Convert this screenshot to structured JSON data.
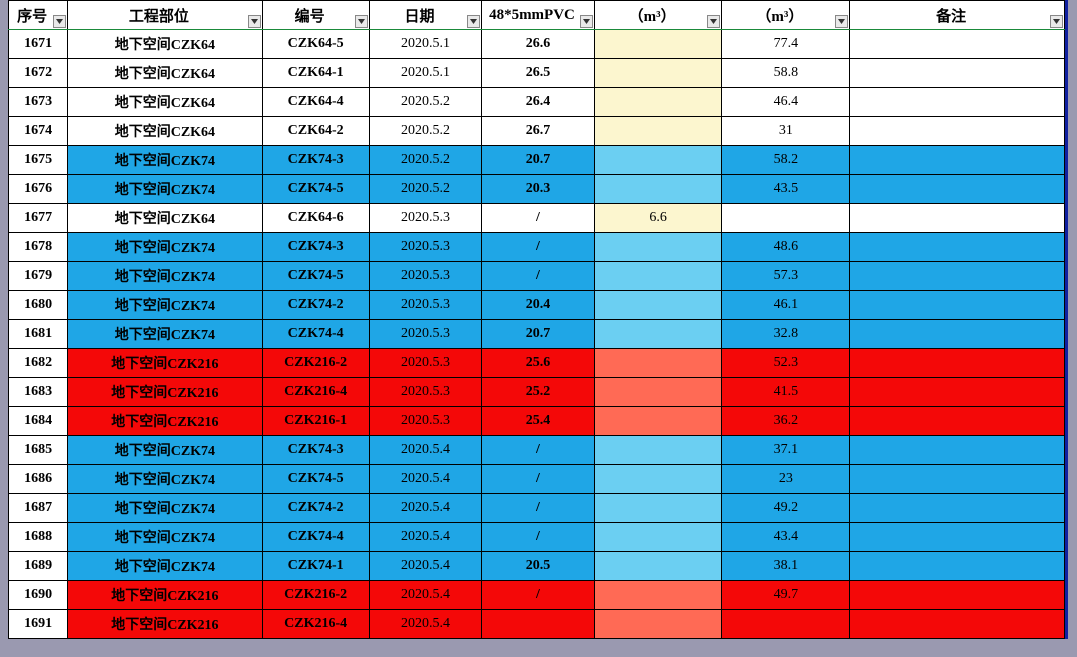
{
  "headers": {
    "seq": "序号",
    "part": "工程部位",
    "code": "编号",
    "date": "日期",
    "pvc": "48*5mmPVC",
    "m3a": "（m³）",
    "m3b": "（m³）",
    "remark": "备注"
  },
  "rows": [
    {
      "seq": "1671",
      "part": "地下空间CZK64",
      "code": "CZK64-5",
      "date": "2020.5.1",
      "pvc": "26.6",
      "m3a": "",
      "m3b": "77.4",
      "remark": "",
      "fill": "white",
      "c5": "cream"
    },
    {
      "seq": "1672",
      "part": "地下空间CZK64",
      "code": "CZK64-1",
      "date": "2020.5.1",
      "pvc": "26.5",
      "m3a": "",
      "m3b": "58.8",
      "remark": "",
      "fill": "white",
      "c5": "cream"
    },
    {
      "seq": "1673",
      "part": "地下空间CZK64",
      "code": "CZK64-4",
      "date": "2020.5.2",
      "pvc": "26.4",
      "m3a": "",
      "m3b": "46.4",
      "remark": "",
      "fill": "white",
      "c5": "cream"
    },
    {
      "seq": "1674",
      "part": "地下空间CZK64",
      "code": "CZK64-2",
      "date": "2020.5.2",
      "pvc": "26.7",
      "m3a": "",
      "m3b": "31",
      "remark": "",
      "fill": "white",
      "c5": "cream"
    },
    {
      "seq": "1675",
      "part": "地下空间CZK74",
      "code": "CZK74-3",
      "date": "2020.5.2",
      "pvc": "20.7",
      "m3a": "",
      "m3b": "58.2",
      "remark": "",
      "fill": "blue",
      "c5": "ltblue"
    },
    {
      "seq": "1676",
      "part": "地下空间CZK74",
      "code": "CZK74-5",
      "date": "2020.5.2",
      "pvc": "20.3",
      "m3a": "",
      "m3b": "43.5",
      "remark": "",
      "fill": "blue",
      "c5": "ltblue"
    },
    {
      "seq": "1677",
      "part": "地下空间CZK64",
      "code": "CZK64-6",
      "date": "2020.5.3",
      "pvc": "/",
      "m3a": "6.6",
      "m3b": "",
      "remark": "",
      "fill": "white",
      "c5": "cream"
    },
    {
      "seq": "1678",
      "part": "地下空间CZK74",
      "code": "CZK74-3",
      "date": "2020.5.3",
      "pvc": "/",
      "m3a": "",
      "m3b": "48.6",
      "remark": "",
      "fill": "blue",
      "c5": "ltblue"
    },
    {
      "seq": "1679",
      "part": "地下空间CZK74",
      "code": "CZK74-5",
      "date": "2020.5.3",
      "pvc": "/",
      "m3a": "",
      "m3b": "57.3",
      "remark": "",
      "fill": "blue",
      "c5": "ltblue"
    },
    {
      "seq": "1680",
      "part": "地下空间CZK74",
      "code": "CZK74-2",
      "date": "2020.5.3",
      "pvc": "20.4",
      "m3a": "",
      "m3b": "46.1",
      "remark": "",
      "fill": "blue",
      "c5": "ltblue"
    },
    {
      "seq": "1681",
      "part": "地下空间CZK74",
      "code": "CZK74-4",
      "date": "2020.5.3",
      "pvc": "20.7",
      "m3a": "",
      "m3b": "32.8",
      "remark": "",
      "fill": "blue",
      "c5": "ltblue"
    },
    {
      "seq": "1682",
      "part": "地下空间CZK216",
      "code": "CZK216-2",
      "date": "2020.5.3",
      "pvc": "25.6",
      "m3a": "",
      "m3b": "52.3",
      "remark": "",
      "fill": "red",
      "c5": "salmon"
    },
    {
      "seq": "1683",
      "part": "地下空间CZK216",
      "code": "CZK216-4",
      "date": "2020.5.3",
      "pvc": "25.2",
      "m3a": "",
      "m3b": "41.5",
      "remark": "",
      "fill": "red",
      "c5": "salmon"
    },
    {
      "seq": "1684",
      "part": "地下空间CZK216",
      "code": "CZK216-1",
      "date": "2020.5.3",
      "pvc": "25.4",
      "m3a": "",
      "m3b": "36.2",
      "remark": "",
      "fill": "red",
      "c5": "salmon"
    },
    {
      "seq": "1685",
      "part": "地下空间CZK74",
      "code": "CZK74-3",
      "date": "2020.5.4",
      "pvc": "/",
      "m3a": "",
      "m3b": "37.1",
      "remark": "",
      "fill": "blue",
      "c5": "ltblue"
    },
    {
      "seq": "1686",
      "part": "地下空间CZK74",
      "code": "CZK74-5",
      "date": "2020.5.4",
      "pvc": "/",
      "m3a": "",
      "m3b": "23",
      "remark": "",
      "fill": "blue",
      "c5": "ltblue"
    },
    {
      "seq": "1687",
      "part": "地下空间CZK74",
      "code": "CZK74-2",
      "date": "2020.5.4",
      "pvc": "/",
      "m3a": "",
      "m3b": "49.2",
      "remark": "",
      "fill": "blue",
      "c5": "ltblue"
    },
    {
      "seq": "1688",
      "part": "地下空间CZK74",
      "code": "CZK74-4",
      "date": "2020.5.4",
      "pvc": "/",
      "m3a": "",
      "m3b": "43.4",
      "remark": "",
      "fill": "blue",
      "c5": "ltblue"
    },
    {
      "seq": "1689",
      "part": "地下空间CZK74",
      "code": "CZK74-1",
      "date": "2020.5.4",
      "pvc": "20.5",
      "m3a": "",
      "m3b": "38.1",
      "remark": "",
      "fill": "blue",
      "c5": "ltblue"
    },
    {
      "seq": "1690",
      "part": "地下空间CZK216",
      "code": "CZK216-2",
      "date": "2020.5.4",
      "pvc": "/",
      "m3a": "",
      "m3b": "49.7",
      "remark": "",
      "fill": "red",
      "c5": "salmon"
    },
    {
      "seq": "1691",
      "part": "地下空间CZK216",
      "code": "CZK216-4",
      "date": "2020.5.4",
      "pvc": "",
      "m3a": "",
      "m3b": "",
      "remark": "",
      "fill": "red",
      "c5": "salmon"
    }
  ]
}
